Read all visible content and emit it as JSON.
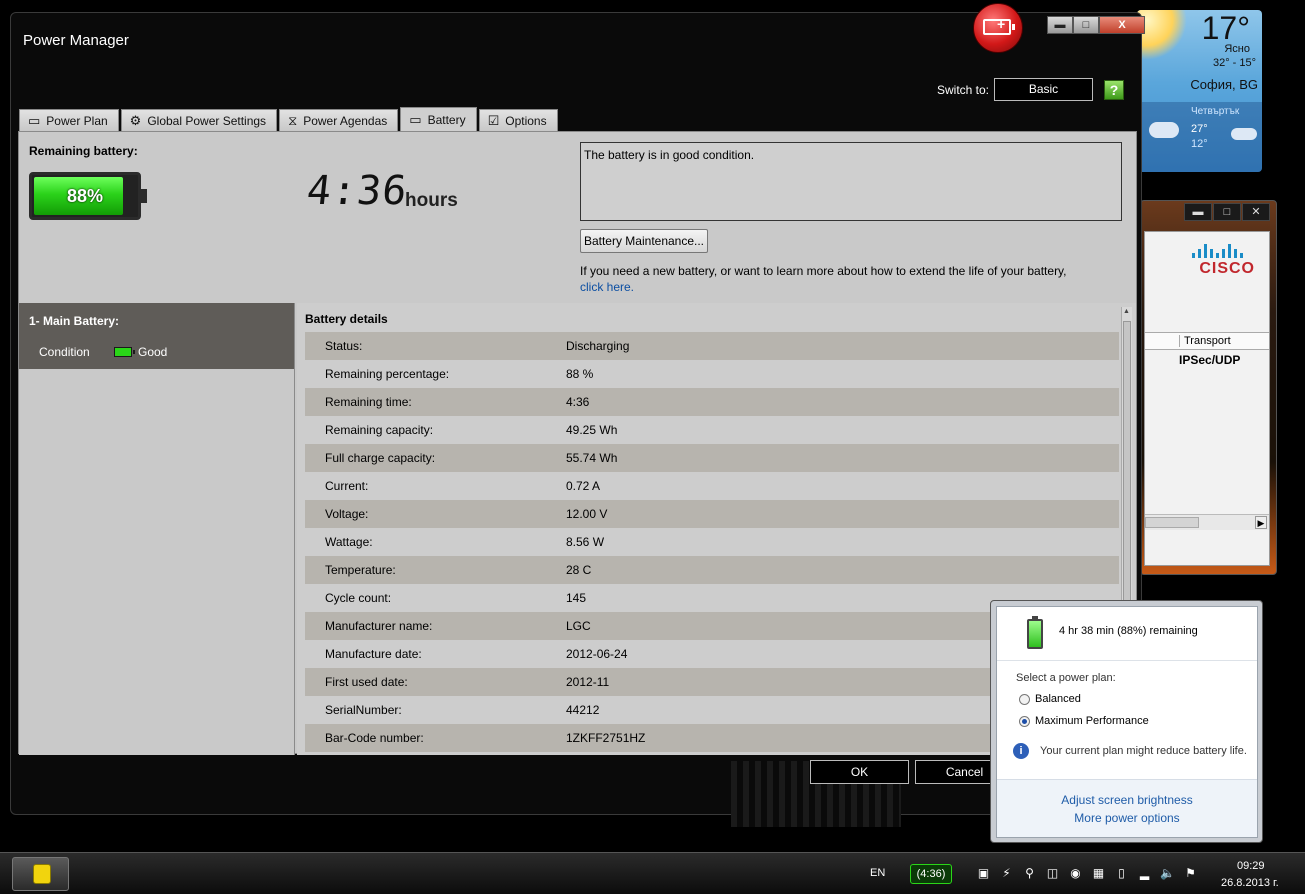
{
  "weather": {
    "temp": "17°",
    "desc": "Ясно",
    "range": "32° - 15°",
    "city": "София, BG",
    "next_day": "Четвъртък",
    "next_hi": "27°",
    "next_lo": "12°"
  },
  "cisco": {
    "logo": "CISCO",
    "column_header": "Transport",
    "cell_value": "IPSec/UDP"
  },
  "power_manager": {
    "title": "Power Manager",
    "switch_label": "Switch to:",
    "switch_button": "Basic",
    "help_icon": "?",
    "tabs": [
      {
        "label": "Power Plan",
        "icon": "power-plan-icon"
      },
      {
        "label": "Global Power Settings",
        "icon": "gear-icon"
      },
      {
        "label": "Power Agendas",
        "icon": "clock-icon"
      },
      {
        "label": "Battery",
        "icon": "battery-icon",
        "active": true
      },
      {
        "label": "Options",
        "icon": "checkbox-icon"
      }
    ],
    "remaining_label": "Remaining battery:",
    "battery_percent": "88%",
    "battery_fill": 0.88,
    "time_value": "4:36",
    "time_unit": "hours",
    "status_text": "The battery is in good condition.",
    "maintenance_button": "Battery Maintenance...",
    "info_text": "If you need a new battery, or want to learn more about how to extend the life of your battery,",
    "info_link": "click here.",
    "side": {
      "heading": "1- Main Battery:",
      "condition_label": "Condition",
      "condition_value": "Good"
    },
    "details_heading": "Battery details",
    "details": [
      {
        "key": "Status:",
        "value": "Discharging"
      },
      {
        "key": "Remaining percentage:",
        "value": "88 %"
      },
      {
        "key": "Remaining time:",
        "value": "4:36"
      },
      {
        "key": "Remaining capacity:",
        "value": "49.25 Wh"
      },
      {
        "key": "Full charge capacity:",
        "value": "55.74 Wh"
      },
      {
        "key": "Current:",
        "value": "0.72 A"
      },
      {
        "key": "Voltage:",
        "value": "12.00 V"
      },
      {
        "key": "Wattage:",
        "value": "8.56 W"
      },
      {
        "key": "Temperature:",
        "value": "28 C"
      },
      {
        "key": "Cycle count:",
        "value": "145"
      },
      {
        "key": "Manufacturer name:",
        "value": "LGC"
      },
      {
        "key": "Manufacture date:",
        "value": "2012-06-24"
      },
      {
        "key": "First used date:",
        "value": "2012-11"
      },
      {
        "key": "SerialNumber:",
        "value": "44212"
      },
      {
        "key": "Bar-Code number:",
        "value": "1ZKFF2751HZ"
      }
    ],
    "ok_button": "OK",
    "cancel_button": "Cancel"
  },
  "flyout": {
    "remaining": "4 hr 38 min (88%) remaining",
    "select_plan": "Select a power plan:",
    "plans": [
      {
        "label": "Balanced",
        "selected": false
      },
      {
        "label": "Maximum Performance",
        "selected": true
      }
    ],
    "warning": "Your current plan might reduce battery life.",
    "link_brightness": "Adjust screen brightness",
    "link_more": "More power options"
  },
  "taskbar": {
    "language": "EN",
    "battery_time": "(4:36)",
    "time": "09:29",
    "date": "26.8.2013 г."
  },
  "colors": {
    "battery_green": "#2bd21a",
    "link_blue": "#0b4ea2",
    "close_red": "#c0402b"
  }
}
